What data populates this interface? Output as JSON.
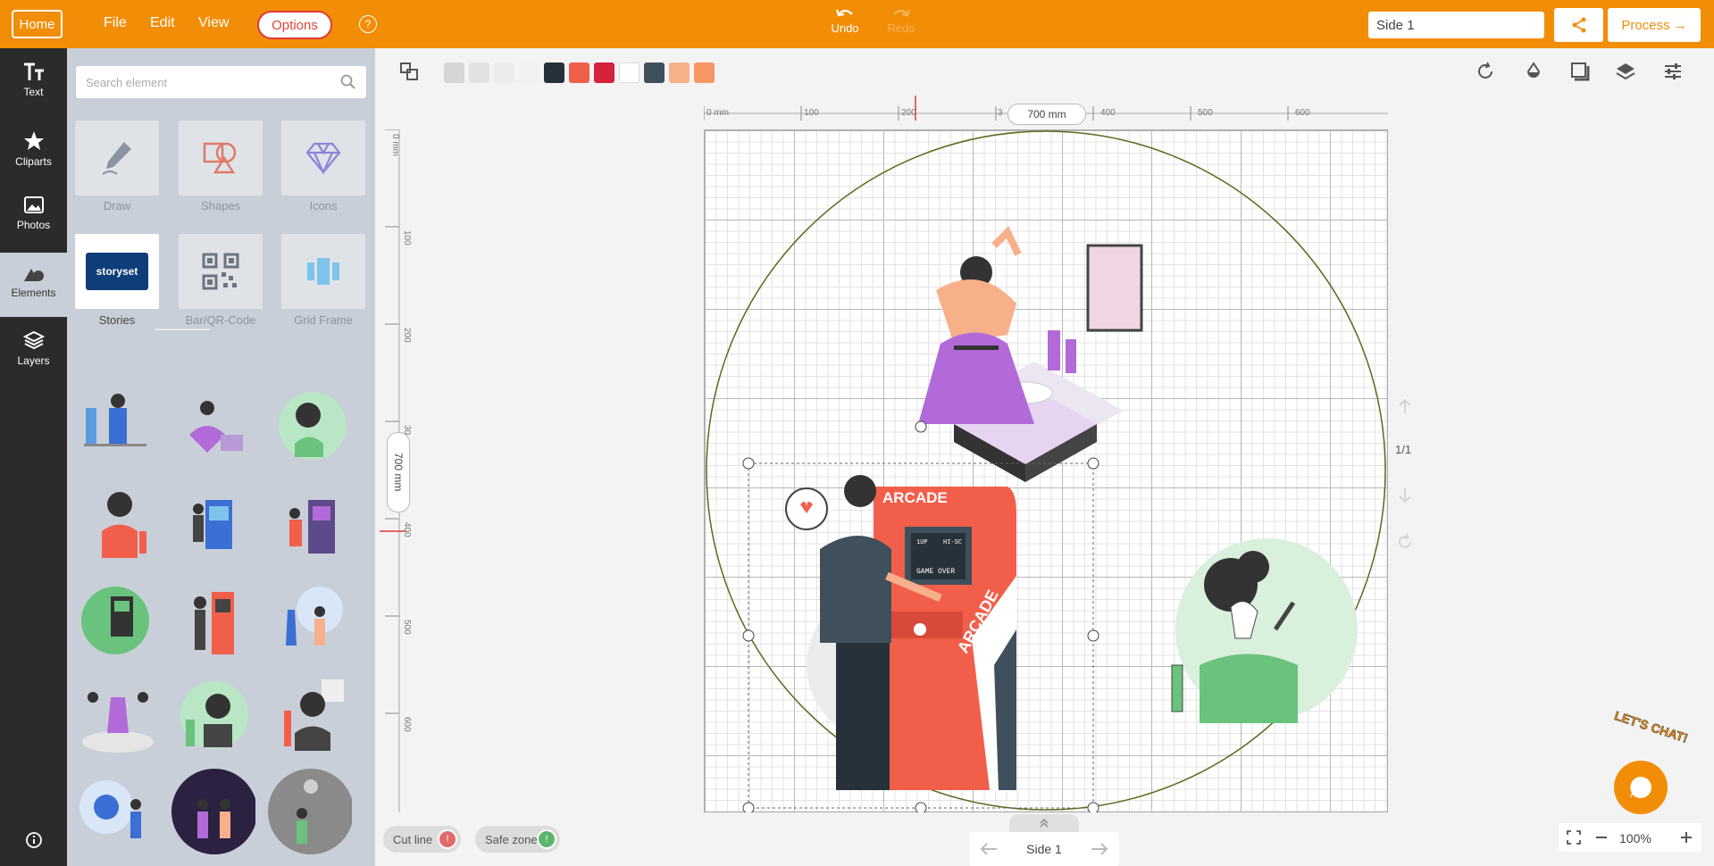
{
  "topbar": {
    "home_label": "Home",
    "menu": [
      "File",
      "Edit",
      "View"
    ],
    "options_label": "Options",
    "help_label": "?",
    "undo_label": "Undo",
    "redo_label": "Redo",
    "side_value": "Side 1",
    "process_label": "Process →"
  },
  "leftnav": {
    "items": [
      {
        "label": "Text",
        "icon": "text-icon"
      },
      {
        "label": "Cliparts",
        "icon": "star-icon"
      },
      {
        "label": "Photos",
        "icon": "photo-icon"
      },
      {
        "label": "Elements",
        "icon": "shapes-icon"
      },
      {
        "label": "Layers",
        "icon": "layers-icon"
      }
    ],
    "info_icon": "info-icon"
  },
  "panel": {
    "search_placeholder": "Search element",
    "tiles": [
      {
        "label": "Draw",
        "icon": "pen-icon"
      },
      {
        "label": "Shapes",
        "icon": "shapes-icon"
      },
      {
        "label": "Icons",
        "icon": "diamond-icon"
      },
      {
        "label": "Stories",
        "icon": "storyset-logo",
        "logo_text": "storyset"
      },
      {
        "label": "Bar/QR-Code",
        "icon": "qr-code-icon"
      },
      {
        "label": "Grid Frame",
        "icon": "grid-frame-icon"
      }
    ]
  },
  "colors": {
    "brand": "#f28d07",
    "options_border": "#e03a3a",
    "swatches": [
      "#d6d6d6",
      "#e2e2e2",
      "#ececec",
      "#f1f1f1",
      "#27313a",
      "#f15f4b",
      "#d4233a",
      "#ffffff",
      "#3f505c",
      "#f8b08a",
      "#f79565"
    ]
  },
  "rulers": {
    "horizontal": [
      "0 mm",
      "100",
      "200",
      "3",
      "400",
      "500",
      "600"
    ],
    "vertical": [
      "0 mm",
      "100",
      "200",
      "30",
      "400",
      "500",
      "600"
    ],
    "width_label": "700 mm",
    "height_label": "700 mm"
  },
  "canvas": {
    "page_indicator": "1/1",
    "arcade_sign": "ARCADE",
    "arcade_side": "ARCADE",
    "screen_text": "GAME OVER",
    "screen_score_1": "1UP",
    "screen_score_2": "HI-SC"
  },
  "bottom": {
    "cut_line_label": "Cut line",
    "safe_zone_label": "Safe zone",
    "side_label": "Side 1",
    "zoom_value": "100%",
    "chat_label": "LET'S CHAT!"
  }
}
